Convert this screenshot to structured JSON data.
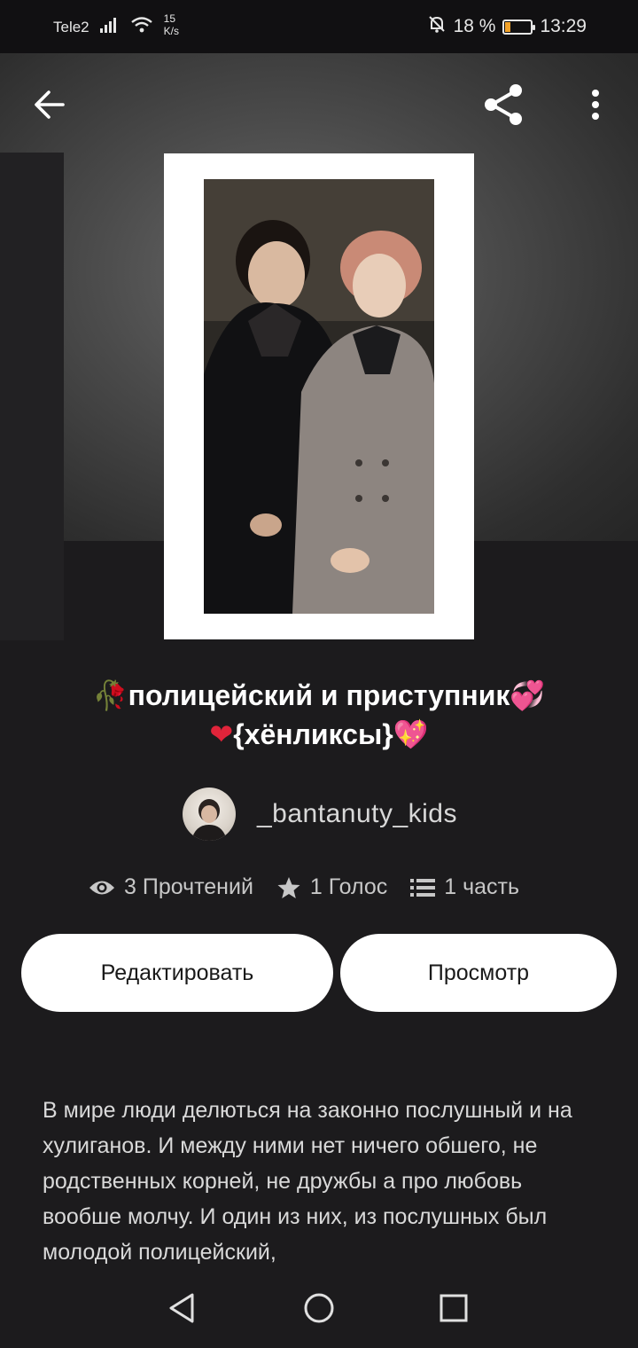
{
  "status_bar": {
    "carrier": "Tele2",
    "speed_value": "15",
    "speed_unit": "K/s",
    "battery": "18 %",
    "time": "13:29"
  },
  "app_bar": {
    "back_icon": "arrow-left-icon",
    "share_icon": "share-icon",
    "more_icon": "more-vertical-icon"
  },
  "story": {
    "title_line1": "полицейский и приступник",
    "title_line2": "{хёнликсы}",
    "author": "_bantanuty_kids",
    "stats": {
      "reads": "3 Прочтений",
      "votes": "1 Голос",
      "parts": "1 часть"
    },
    "edit_label": "Редактировать",
    "view_label": "Просмотр",
    "description": "В мире люди делються на законно послушный и на хулиганов. И между ними нет ничего обшего, не родственных корней, не дружбы а про любовь вообше молчу. И один из них, из послушных был молодой полицейский,"
  },
  "colors": {
    "background": "#1c1b1d",
    "button_bg": "#ffffff",
    "accent_red": "#e0243a"
  }
}
